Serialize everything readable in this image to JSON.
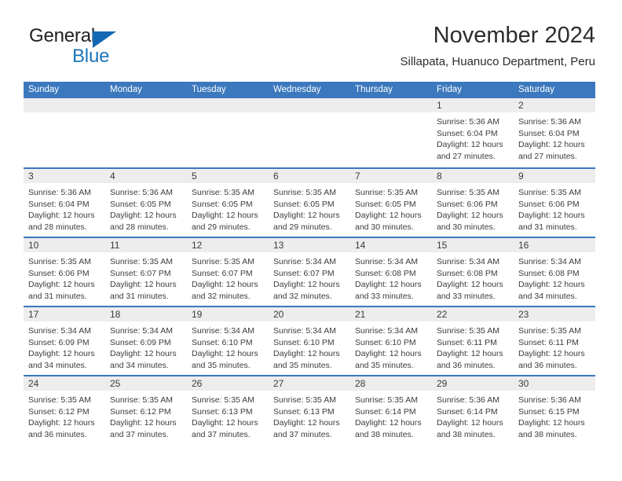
{
  "brand": {
    "name_top": "General",
    "name_bottom": "Blue",
    "accent_color": "#1b75bb",
    "triangle_color": "#1268b3"
  },
  "header": {
    "title": "November 2024",
    "subtitle": "Sillapata, Huanuco Department, Peru"
  },
  "theme": {
    "header_blue": "#3b78bd",
    "day_band_gray": "#ededed",
    "text_color": "#3c3c3c"
  },
  "weekdays": [
    "Sunday",
    "Monday",
    "Tuesday",
    "Wednesday",
    "Thursday",
    "Friday",
    "Saturday"
  ],
  "weeks": [
    [
      {
        "day": "",
        "lines": []
      },
      {
        "day": "",
        "lines": []
      },
      {
        "day": "",
        "lines": []
      },
      {
        "day": "",
        "lines": []
      },
      {
        "day": "",
        "lines": []
      },
      {
        "day": "1",
        "lines": [
          "Sunrise: 5:36 AM",
          "Sunset: 6:04 PM",
          "Daylight: 12 hours",
          "and 27 minutes."
        ]
      },
      {
        "day": "2",
        "lines": [
          "Sunrise: 5:36 AM",
          "Sunset: 6:04 PM",
          "Daylight: 12 hours",
          "and 27 minutes."
        ]
      }
    ],
    [
      {
        "day": "3",
        "lines": [
          "Sunrise: 5:36 AM",
          "Sunset: 6:04 PM",
          "Daylight: 12 hours",
          "and 28 minutes."
        ]
      },
      {
        "day": "4",
        "lines": [
          "Sunrise: 5:36 AM",
          "Sunset: 6:05 PM",
          "Daylight: 12 hours",
          "and 28 minutes."
        ]
      },
      {
        "day": "5",
        "lines": [
          "Sunrise: 5:35 AM",
          "Sunset: 6:05 PM",
          "Daylight: 12 hours",
          "and 29 minutes."
        ]
      },
      {
        "day": "6",
        "lines": [
          "Sunrise: 5:35 AM",
          "Sunset: 6:05 PM",
          "Daylight: 12 hours",
          "and 29 minutes."
        ]
      },
      {
        "day": "7",
        "lines": [
          "Sunrise: 5:35 AM",
          "Sunset: 6:05 PM",
          "Daylight: 12 hours",
          "and 30 minutes."
        ]
      },
      {
        "day": "8",
        "lines": [
          "Sunrise: 5:35 AM",
          "Sunset: 6:06 PM",
          "Daylight: 12 hours",
          "and 30 minutes."
        ]
      },
      {
        "day": "9",
        "lines": [
          "Sunrise: 5:35 AM",
          "Sunset: 6:06 PM",
          "Daylight: 12 hours",
          "and 31 minutes."
        ]
      }
    ],
    [
      {
        "day": "10",
        "lines": [
          "Sunrise: 5:35 AM",
          "Sunset: 6:06 PM",
          "Daylight: 12 hours",
          "and 31 minutes."
        ]
      },
      {
        "day": "11",
        "lines": [
          "Sunrise: 5:35 AM",
          "Sunset: 6:07 PM",
          "Daylight: 12 hours",
          "and 31 minutes."
        ]
      },
      {
        "day": "12",
        "lines": [
          "Sunrise: 5:35 AM",
          "Sunset: 6:07 PM",
          "Daylight: 12 hours",
          "and 32 minutes."
        ]
      },
      {
        "day": "13",
        "lines": [
          "Sunrise: 5:34 AM",
          "Sunset: 6:07 PM",
          "Daylight: 12 hours",
          "and 32 minutes."
        ]
      },
      {
        "day": "14",
        "lines": [
          "Sunrise: 5:34 AM",
          "Sunset: 6:08 PM",
          "Daylight: 12 hours",
          "and 33 minutes."
        ]
      },
      {
        "day": "15",
        "lines": [
          "Sunrise: 5:34 AM",
          "Sunset: 6:08 PM",
          "Daylight: 12 hours",
          "and 33 minutes."
        ]
      },
      {
        "day": "16",
        "lines": [
          "Sunrise: 5:34 AM",
          "Sunset: 6:08 PM",
          "Daylight: 12 hours",
          "and 34 minutes."
        ]
      }
    ],
    [
      {
        "day": "17",
        "lines": [
          "Sunrise: 5:34 AM",
          "Sunset: 6:09 PM",
          "Daylight: 12 hours",
          "and 34 minutes."
        ]
      },
      {
        "day": "18",
        "lines": [
          "Sunrise: 5:34 AM",
          "Sunset: 6:09 PM",
          "Daylight: 12 hours",
          "and 34 minutes."
        ]
      },
      {
        "day": "19",
        "lines": [
          "Sunrise: 5:34 AM",
          "Sunset: 6:10 PM",
          "Daylight: 12 hours",
          "and 35 minutes."
        ]
      },
      {
        "day": "20",
        "lines": [
          "Sunrise: 5:34 AM",
          "Sunset: 6:10 PM",
          "Daylight: 12 hours",
          "and 35 minutes."
        ]
      },
      {
        "day": "21",
        "lines": [
          "Sunrise: 5:34 AM",
          "Sunset: 6:10 PM",
          "Daylight: 12 hours",
          "and 35 minutes."
        ]
      },
      {
        "day": "22",
        "lines": [
          "Sunrise: 5:35 AM",
          "Sunset: 6:11 PM",
          "Daylight: 12 hours",
          "and 36 minutes."
        ]
      },
      {
        "day": "23",
        "lines": [
          "Sunrise: 5:35 AM",
          "Sunset: 6:11 PM",
          "Daylight: 12 hours",
          "and 36 minutes."
        ]
      }
    ],
    [
      {
        "day": "24",
        "lines": [
          "Sunrise: 5:35 AM",
          "Sunset: 6:12 PM",
          "Daylight: 12 hours",
          "and 36 minutes."
        ]
      },
      {
        "day": "25",
        "lines": [
          "Sunrise: 5:35 AM",
          "Sunset: 6:12 PM",
          "Daylight: 12 hours",
          "and 37 minutes."
        ]
      },
      {
        "day": "26",
        "lines": [
          "Sunrise: 5:35 AM",
          "Sunset: 6:13 PM",
          "Daylight: 12 hours",
          "and 37 minutes."
        ]
      },
      {
        "day": "27",
        "lines": [
          "Sunrise: 5:35 AM",
          "Sunset: 6:13 PM",
          "Daylight: 12 hours",
          "and 37 minutes."
        ]
      },
      {
        "day": "28",
        "lines": [
          "Sunrise: 5:35 AM",
          "Sunset: 6:14 PM",
          "Daylight: 12 hours",
          "and 38 minutes."
        ]
      },
      {
        "day": "29",
        "lines": [
          "Sunrise: 5:36 AM",
          "Sunset: 6:14 PM",
          "Daylight: 12 hours",
          "and 38 minutes."
        ]
      },
      {
        "day": "30",
        "lines": [
          "Sunrise: 5:36 AM",
          "Sunset: 6:15 PM",
          "Daylight: 12 hours",
          "and 38 minutes."
        ]
      }
    ]
  ]
}
